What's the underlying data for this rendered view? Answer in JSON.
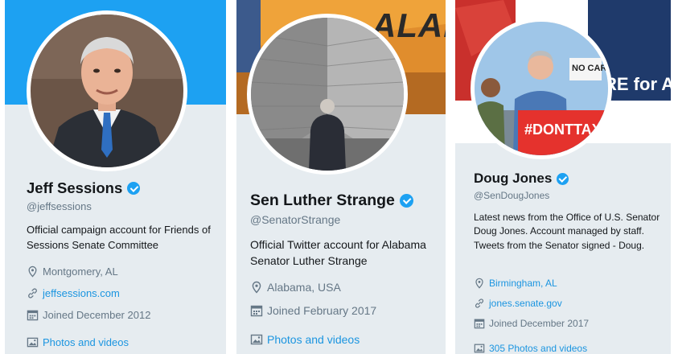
{
  "colors": {
    "link": "#1b95e0",
    "verified": "#1da1f2",
    "muted": "#657786",
    "card_bg": "#e6ecf0",
    "banner_sessions": "#1da1f2"
  },
  "profiles": [
    {
      "name": "Jeff Sessions",
      "handle": "@jeffsessions",
      "bio": "Official campaign account for Friends of Sessions Senate Committee",
      "location": "Montgomery, AL",
      "website": "jeffsessions.com",
      "joined": "Joined December 2012",
      "photos": "Photos and videos",
      "icons": [
        "location-pin-icon",
        "link-icon",
        "calendar-icon",
        "photo-icon"
      ]
    },
    {
      "name": "Sen Luther Strange",
      "handle": "@SenatorStrange",
      "bio": "Official Twitter account for Alabama Senator Luther Strange",
      "location": "Alabama, USA",
      "joined": "Joined February 2017",
      "photos": "Photos and videos",
      "banner_text": "ALABA",
      "icons": [
        "location-pin-icon",
        "calendar-icon",
        "photo-icon"
      ]
    },
    {
      "name": "Doug Jones",
      "handle": "@SenDougJones",
      "bio": "Latest news from the Office of U.S. Senator Doug Jones. Account managed by staff. Tweets from the Senator signed - Doug.",
      "location": "Birmingham, AL",
      "website": "jones.senate.gov",
      "joined": "Joined December 2017",
      "photos": "305 Photos and videos",
      "banner_text": "RE for AME",
      "avatar_sign_text": "#DONTTAXME",
      "avatar_placard_text": "NO CAR",
      "icons": [
        "location-pin-icon",
        "link-icon",
        "calendar-icon",
        "photo-icon"
      ]
    }
  ]
}
